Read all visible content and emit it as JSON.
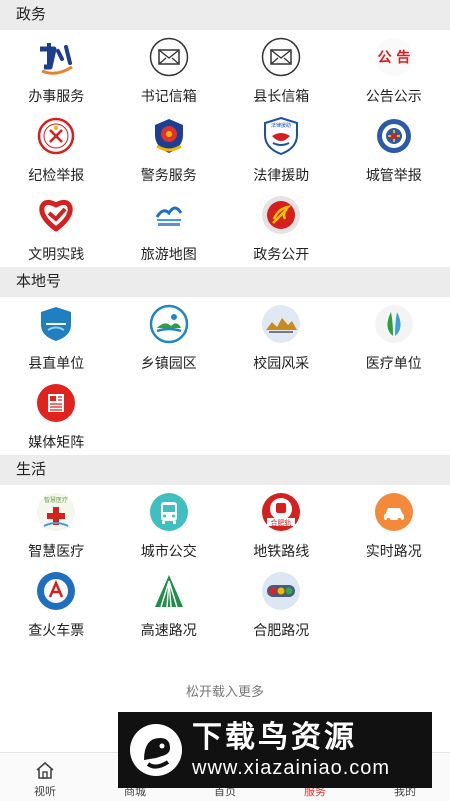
{
  "sections": [
    {
      "title": "政务",
      "items": [
        {
          "label": "办事服务",
          "icon": "ban-logo-icon"
        },
        {
          "label": "书记信箱",
          "icon": "mail-icon"
        },
        {
          "label": "县长信箱",
          "icon": "mail-icon"
        },
        {
          "label": "公告公示",
          "icon": "announcement-icon",
          "icon_text": "公 告"
        },
        {
          "label": "纪检举报",
          "icon": "discipline-emblem-icon"
        },
        {
          "label": "警务服务",
          "icon": "police-badge-icon"
        },
        {
          "label": "法律援助",
          "icon": "legal-aid-shield-icon",
          "icon_text": "法律援助"
        },
        {
          "label": "城管举报",
          "icon": "city-management-badge-icon"
        },
        {
          "label": "文明实践",
          "icon": "heart-ribbon-icon"
        },
        {
          "label": "旅游地图",
          "icon": "tourism-logo-icon"
        },
        {
          "label": "政务公开",
          "icon": "party-emblem-icon"
        }
      ]
    },
    {
      "title": "本地号",
      "items": [
        {
          "label": "县直单位",
          "icon": "county-shield-icon"
        },
        {
          "label": "乡镇园区",
          "icon": "town-circle-icon"
        },
        {
          "label": "校园风采",
          "icon": "campus-circle-icon"
        },
        {
          "label": "医疗单位",
          "icon": "medical-leaf-icon"
        },
        {
          "label": "媒体矩阵",
          "icon": "media-newspaper-icon"
        }
      ]
    },
    {
      "title": "生活",
      "items": [
        {
          "label": "智慧医疗",
          "icon": "smart-medical-icon",
          "icon_text": "智慧医疗"
        },
        {
          "label": "城市公交",
          "icon": "bus-icon"
        },
        {
          "label": "地铁路线",
          "icon": "metro-icon",
          "icon_text": "合肥轨"
        },
        {
          "label": "实时路况",
          "icon": "car-icon"
        },
        {
          "label": "查火车票",
          "icon": "railway-icon"
        },
        {
          "label": "高速路况",
          "icon": "highway-icon"
        },
        {
          "label": "合肥路况",
          "icon": "traffic-light-icon"
        }
      ]
    }
  ],
  "pull_to_load": "松开载入更多",
  "tabs": [
    {
      "label": "视听",
      "icon": "home-icon",
      "active": false
    },
    {
      "label": "商城",
      "icon": "shop-icon",
      "active": false
    },
    {
      "label": "首页",
      "icon": "home-main-icon",
      "active": false
    },
    {
      "label": "服务",
      "icon": "service-icon",
      "active": true
    },
    {
      "label": "我的",
      "icon": "user-icon",
      "active": false
    }
  ],
  "watermark": {
    "title": "下载鸟资源",
    "url": "www.xiazainiao.com"
  },
  "colors": {
    "accent": "#e5322d",
    "section_bg": "#ececec",
    "watermark_bg": "#111111"
  }
}
